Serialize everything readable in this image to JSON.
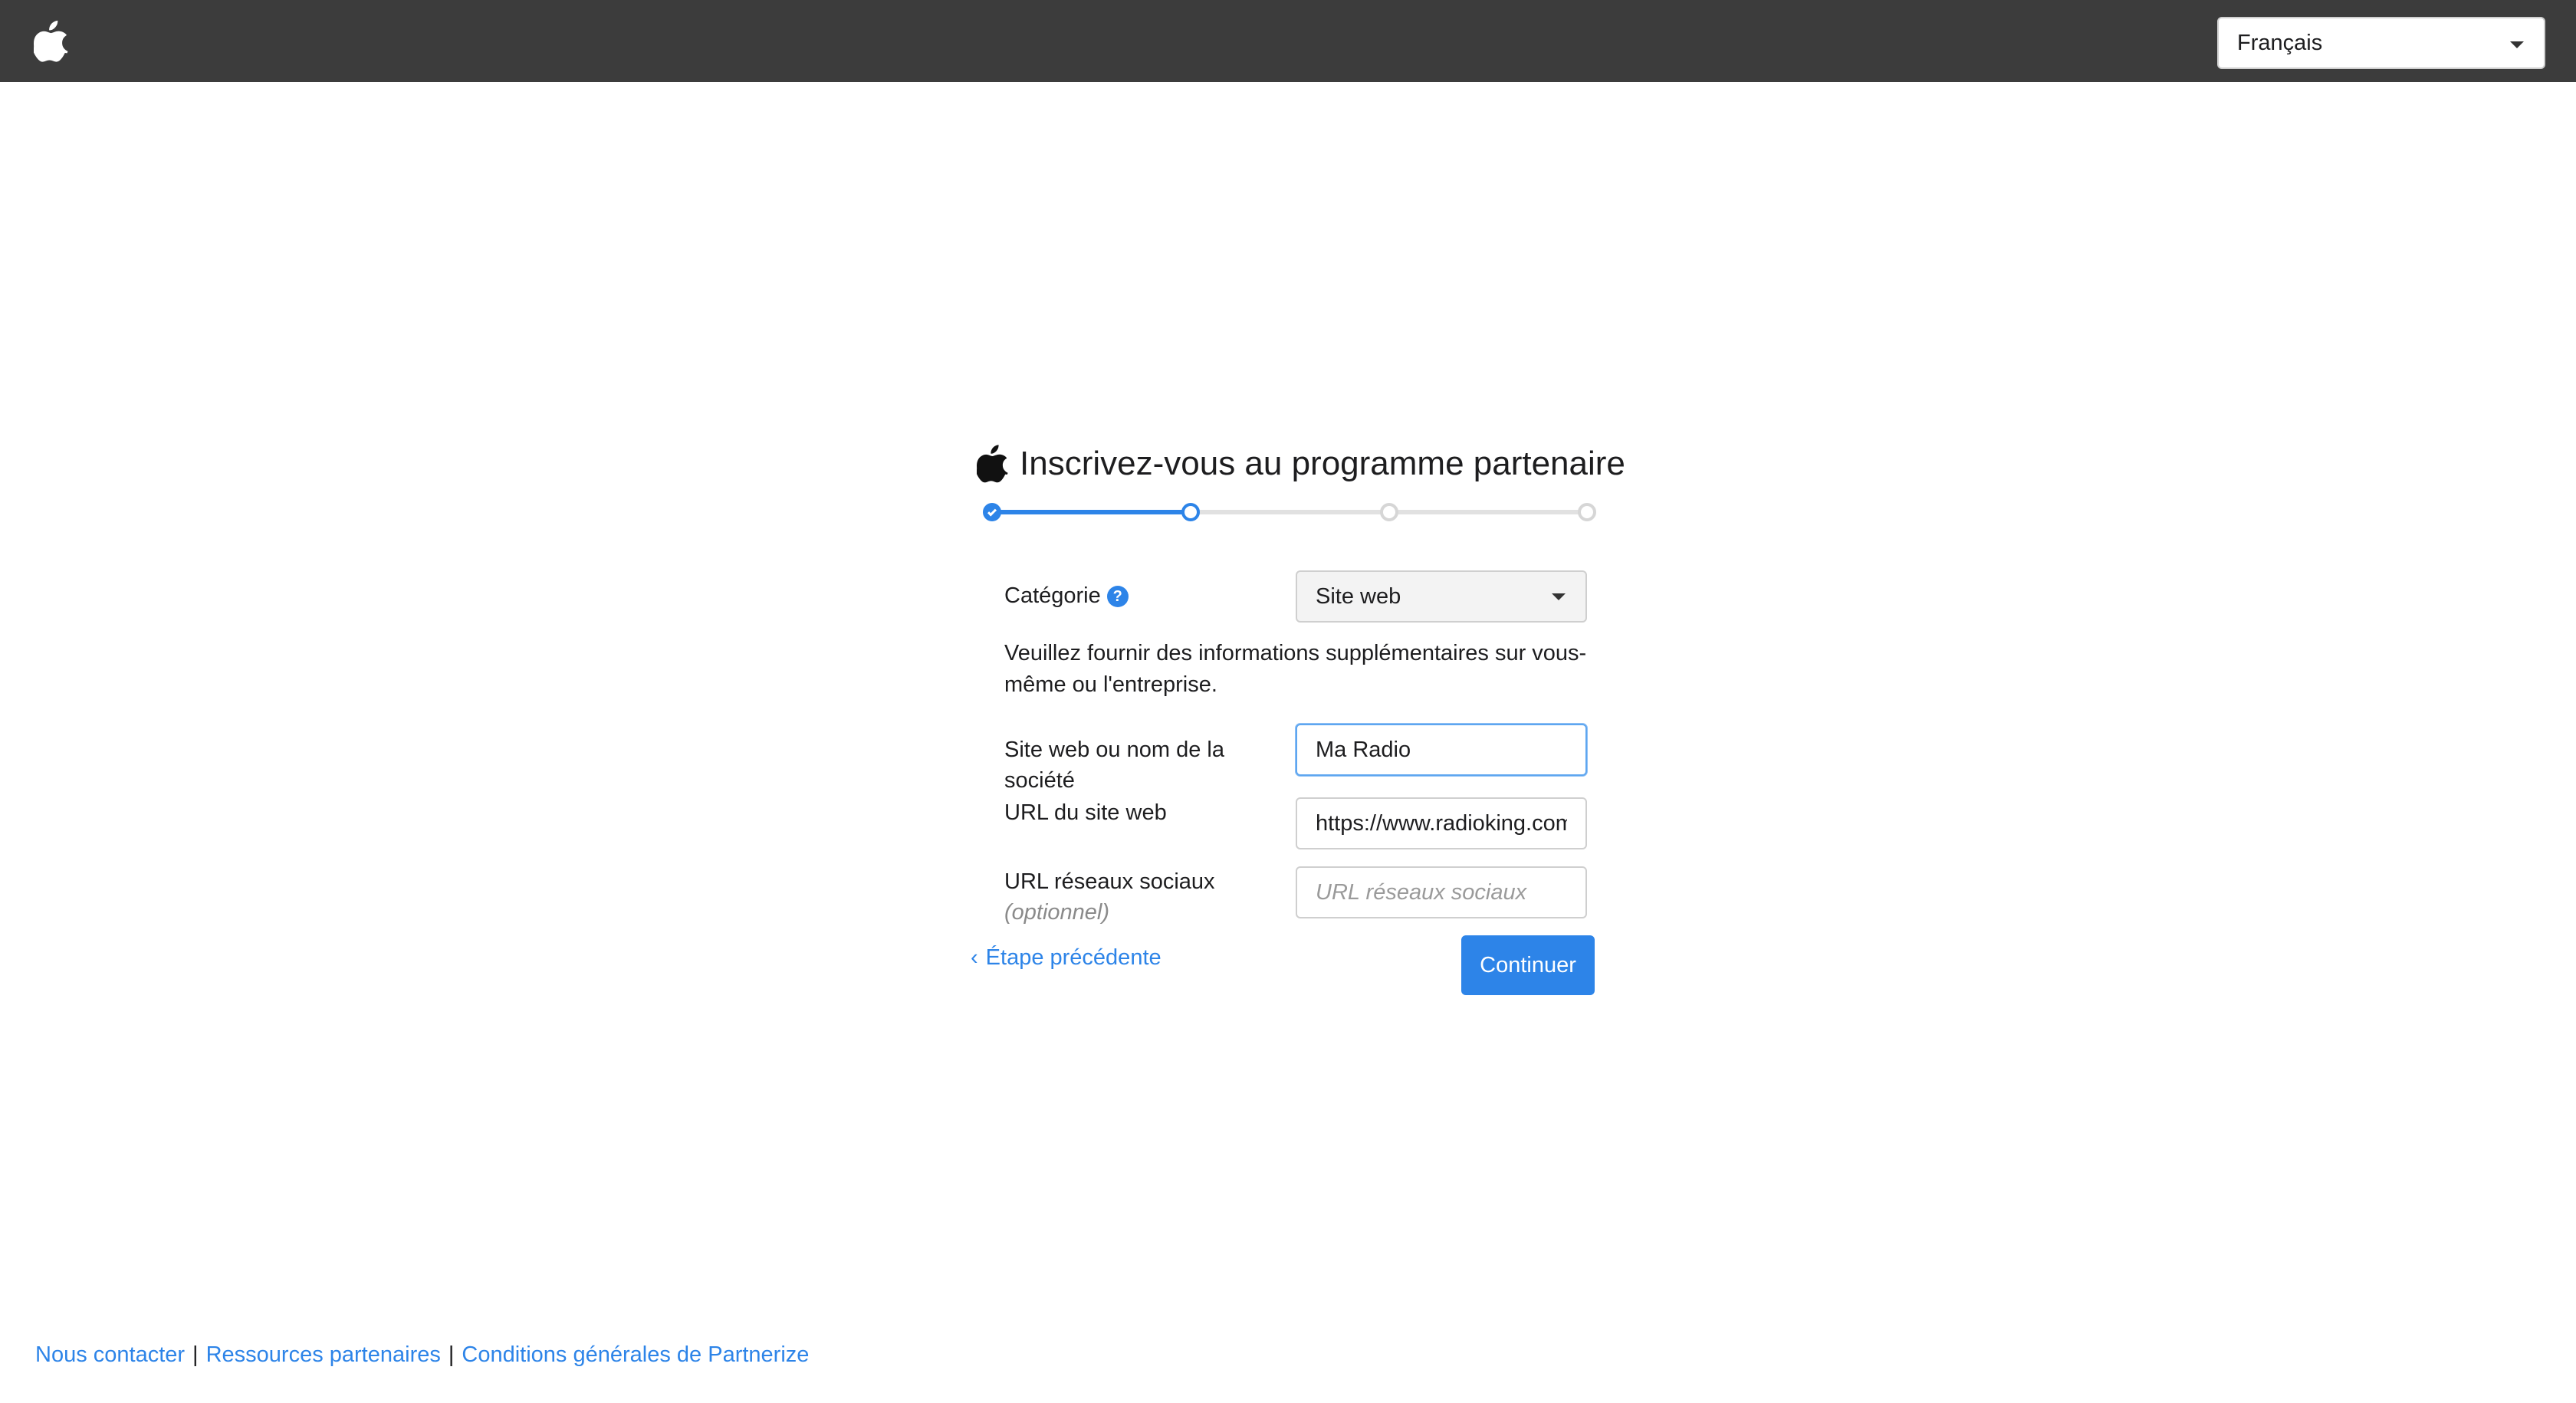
{
  "header": {
    "language": {
      "selected": "Français"
    }
  },
  "signup": {
    "title": "Inscrivez-vous au programme partenaire",
    "progress": {
      "total_steps": 4,
      "current_step": 2
    },
    "category": {
      "label": "Catégorie",
      "help": "?",
      "selected": "Site web"
    },
    "info_text": "Veuillez fournir des informations supplémentaires sur vous-même ou l'entreprise.",
    "company": {
      "label": "Site web ou nom de la société",
      "value": "Ma Radio"
    },
    "website_url": {
      "label": "URL du site web",
      "value": "https://www.radioking.com/"
    },
    "social_url": {
      "label": "URL réseaux sociaux",
      "optional": "(optionnel)",
      "placeholder": "URL réseaux sociaux",
      "value": ""
    },
    "back_label": "Étape précédente",
    "continue_label": "Continuer"
  },
  "footer": {
    "links": [
      "Nous contacter",
      "Ressources partenaires",
      "Conditions générales de Partnerize"
    ],
    "separator": "|"
  },
  "colors": {
    "topbar": "#3c3c3c",
    "accent": "#2d84e8"
  }
}
